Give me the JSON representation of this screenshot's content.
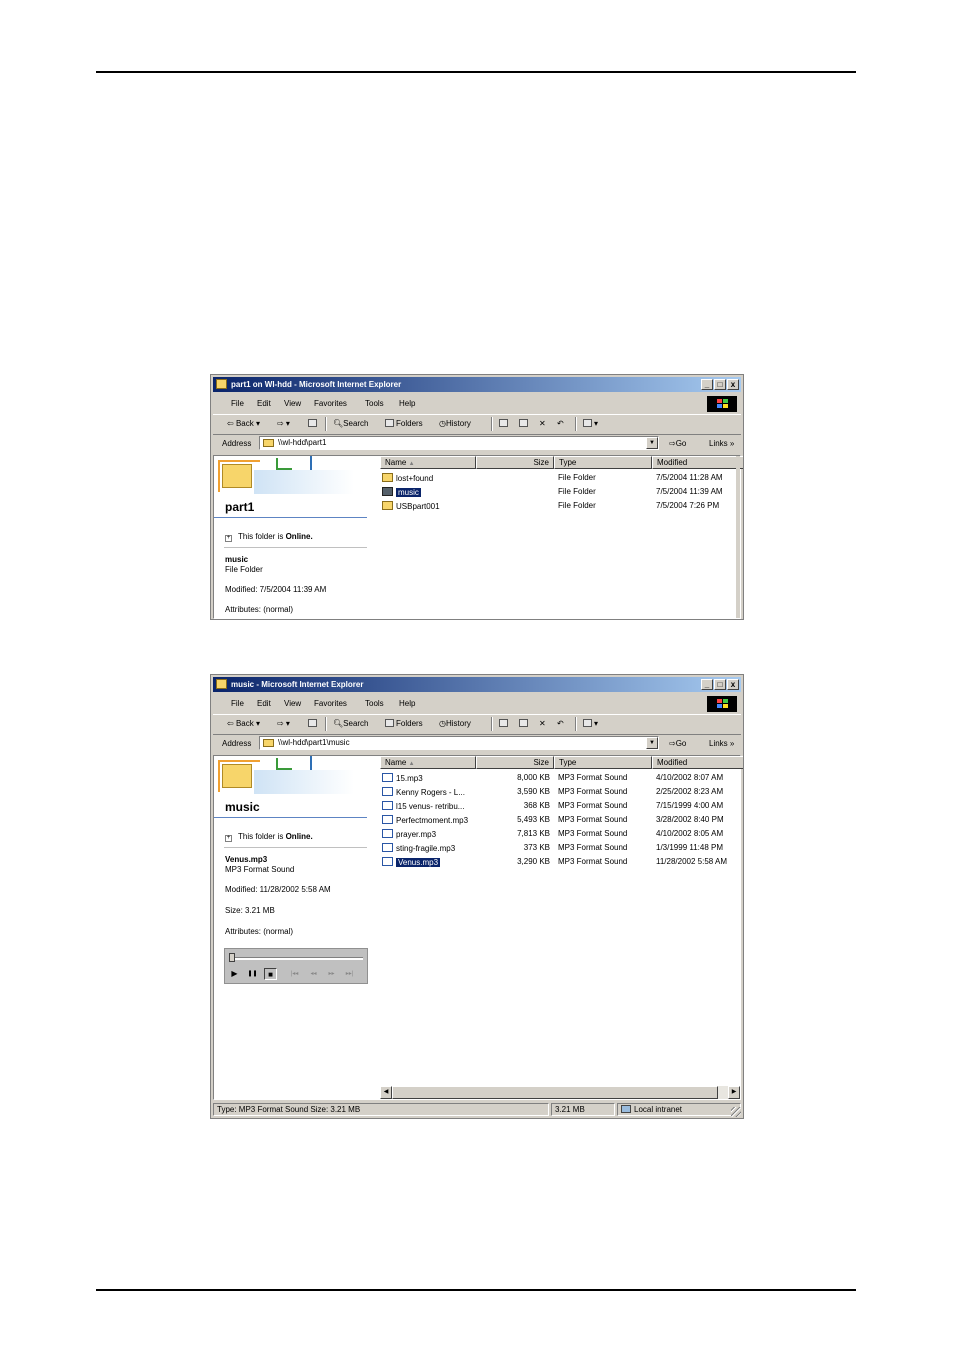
{
  "windows": [
    {
      "title": "part1 on Wl-hdd - Microsoft Internet Explorer",
      "title_buttons": [
        "_",
        "□",
        "x"
      ],
      "menu": [
        "File",
        "Edit",
        "View",
        "Favorites",
        "Tools",
        "Help"
      ],
      "toolbar": {
        "back": "Back",
        "search": "Search",
        "folders": "Folders",
        "history": "History"
      },
      "address_label": "Address",
      "address_value": "\\\\wl-hdd\\part1",
      "go_label": "Go",
      "links_label": "Links",
      "links_more": "»",
      "folder_title": "part1",
      "online_prefix": "This folder is ",
      "online_status": "Online.",
      "selected_name": "music",
      "selected_type": "File Folder",
      "selected_modified": "Modified: 7/5/2004 11:39 AM",
      "selected_size": "",
      "selected_attributes": "Attributes: (normal)",
      "columns": [
        "Name",
        "Size",
        "Type",
        "Modified"
      ],
      "sort_glyph": "▲",
      "rows": [
        {
          "name": "lost+found",
          "size": "",
          "type": "File Folder",
          "modified": "7/5/2004 11:28 AM",
          "icon": "folder-icon",
          "selected": false
        },
        {
          "name": "music",
          "size": "",
          "type": "File Folder",
          "modified": "7/5/2004 11:39 AM",
          "icon": "folder-icon",
          "selected": true
        },
        {
          "name": "USBpart001",
          "size": "",
          "type": "File Folder",
          "modified": "7/5/2004 7:26 PM",
          "icon": "folder-icon",
          "selected": false
        }
      ]
    },
    {
      "title": "music - Microsoft Internet Explorer",
      "title_buttons": [
        "_",
        "□",
        "x"
      ],
      "menu": [
        "File",
        "Edit",
        "View",
        "Favorites",
        "Tools",
        "Help"
      ],
      "toolbar": {
        "back": "Back",
        "search": "Search",
        "folders": "Folders",
        "history": "History"
      },
      "address_label": "Address",
      "address_value": "\\\\wl-hdd\\part1\\music",
      "go_label": "Go",
      "links_label": "Links",
      "links_more": "»",
      "folder_title": "music",
      "online_prefix": "This folder is ",
      "online_status": "Online.",
      "selected_name": "Venus.mp3",
      "selected_type": "MP3 Format Sound",
      "selected_modified": "Modified: 11/28/2002 5:58 AM",
      "selected_size": "Size: 3.21 MB",
      "selected_attributes": "Attributes: (normal)",
      "columns": [
        "Name",
        "Size",
        "Type",
        "Modified"
      ],
      "sort_glyph": "▲",
      "rows": [
        {
          "name": "15.mp3",
          "size": "8,000 KB",
          "type": "MP3 Format Sound",
          "modified": "4/10/2002 8:07 AM",
          "icon": "sound-file-icon",
          "selected": false
        },
        {
          "name": "Kenny Rogers - L...",
          "size": "3,590 KB",
          "type": "MP3 Format Sound",
          "modified": "2/25/2002 8:23 AM",
          "icon": "sound-file-icon",
          "selected": false
        },
        {
          "name": "l15 venus- retribu...",
          "size": "368 KB",
          "type": "MP3 Format Sound",
          "modified": "7/15/1999 4:00 AM",
          "icon": "sound-file-icon",
          "selected": false
        },
        {
          "name": "Perfectmoment.mp3",
          "size": "5,493 KB",
          "type": "MP3 Format Sound",
          "modified": "3/28/2002 8:40 PM",
          "icon": "sound-file-icon",
          "selected": false
        },
        {
          "name": "prayer.mp3",
          "size": "7,813 KB",
          "type": "MP3 Format Sound",
          "modified": "4/10/2002 8:05 AM",
          "icon": "sound-file-icon",
          "selected": false
        },
        {
          "name": "sting-fragile.mp3",
          "size": "373 KB",
          "type": "MP3 Format Sound",
          "modified": "1/3/1999 11:48 PM",
          "icon": "sound-file-icon",
          "selected": false
        },
        {
          "name": "Venus.mp3",
          "size": "3,290 KB",
          "type": "MP3 Format Sound",
          "modified": "11/28/2002 5:58 AM",
          "icon": "sound-file-icon",
          "selected": true
        }
      ],
      "player": {
        "play": "▶",
        "pause": "❚❚",
        "stop": "■",
        "prev": "|◂◂",
        "rew": "◂◂",
        "ffw": "▸▸",
        "next": "▸▸|"
      },
      "status": {
        "info": "Type: MP3 Format Sound Size: 3.21 MB",
        "size": "3.21 MB",
        "zone": "Local intranet"
      }
    }
  ]
}
